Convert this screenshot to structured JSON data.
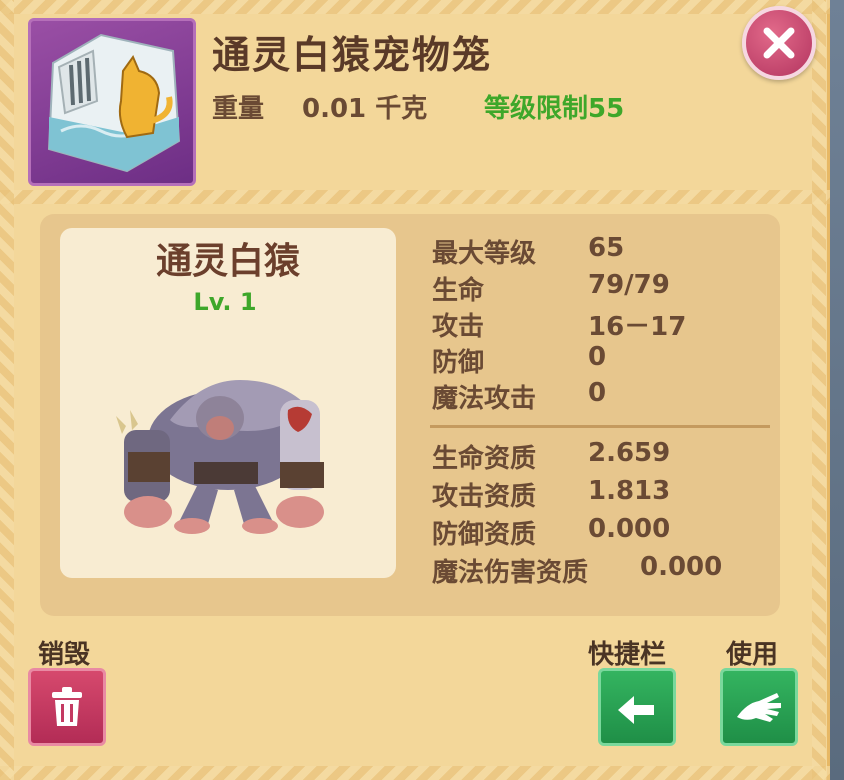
{
  "item": {
    "title": "通灵白猿宠物笼",
    "weight_label": "重量",
    "weight_value": "0.01 千克",
    "level_limit": "等级限制55",
    "icon": "monkey-cage-icon"
  },
  "pet": {
    "name": "通灵白猿",
    "level": "Lv. 1",
    "image": "white-ape-figure"
  },
  "stats": [
    {
      "label": "最大等级",
      "value": "65"
    },
    {
      "label": "生命",
      "value": "79/79"
    },
    {
      "label": "攻击",
      "value": "16－17"
    },
    {
      "label": "防御",
      "value": "0"
    },
    {
      "label": "魔法攻击",
      "value": "0"
    }
  ],
  "aptitudes": [
    {
      "label": "生命资质",
      "value": "2.659"
    },
    {
      "label": "攻击资质",
      "value": "1.813"
    },
    {
      "label": "防御资质",
      "value": "0.000"
    },
    {
      "label": "魔法伤害资质",
      "value": "0.000"
    }
  ],
  "actions": {
    "destroy": "销毁",
    "quickbar": "快捷栏",
    "use": "使用"
  },
  "colors": {
    "panel": "#f3d79a",
    "accent_green": "#3ea72a",
    "button_red": "#c43a62",
    "button_green": "#27a153"
  }
}
